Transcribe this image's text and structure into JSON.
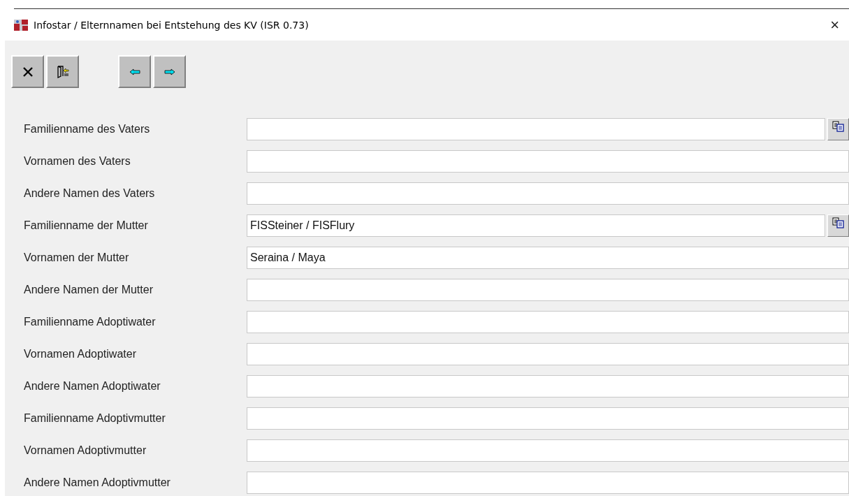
{
  "window": {
    "title": "Infostar /  Elternnamen bei Entstehung des KV (ISR 0.73)",
    "close": "×"
  },
  "toolbar": [
    {
      "kind": "cancel"
    },
    {
      "kind": "exit"
    },
    {
      "kind": "gap"
    },
    {
      "kind": "prev"
    },
    {
      "kind": "next"
    }
  ],
  "fields": [
    {
      "label": "Familienname des Vaters",
      "copy_button": true
    },
    {
      "label": "Vornamen des Vaters",
      "copy_button": false
    },
    {
      "label": "Andere Namen des Vaters",
      "copy_button": false
    },
    {
      "label": "Familienname der Mutter",
      "value": "FISSteiner / FISFlury",
      "copy_button": true
    },
    {
      "label": "Vornamen der Mutter",
      "value": "Seraina / Maya",
      "copy_button": false
    },
    {
      "label": "Andere Namen der Mutter",
      "copy_button": false
    },
    {
      "label": "Familienname Adoptiwater",
      "copy_button": false
    },
    {
      "label": "Vornamen Adoptiwater",
      "copy_button": false
    },
    {
      "label": "Andere Namen Adoptiwater",
      "copy_button": false
    },
    {
      "label": "Familienname Adoptivmutter",
      "copy_button": false
    },
    {
      "label": "Vornamen Adoptivmutter",
      "copy_button": false
    },
    {
      "label": "Andere Namen Adoptivmutter",
      "copy_button": false
    }
  ]
}
